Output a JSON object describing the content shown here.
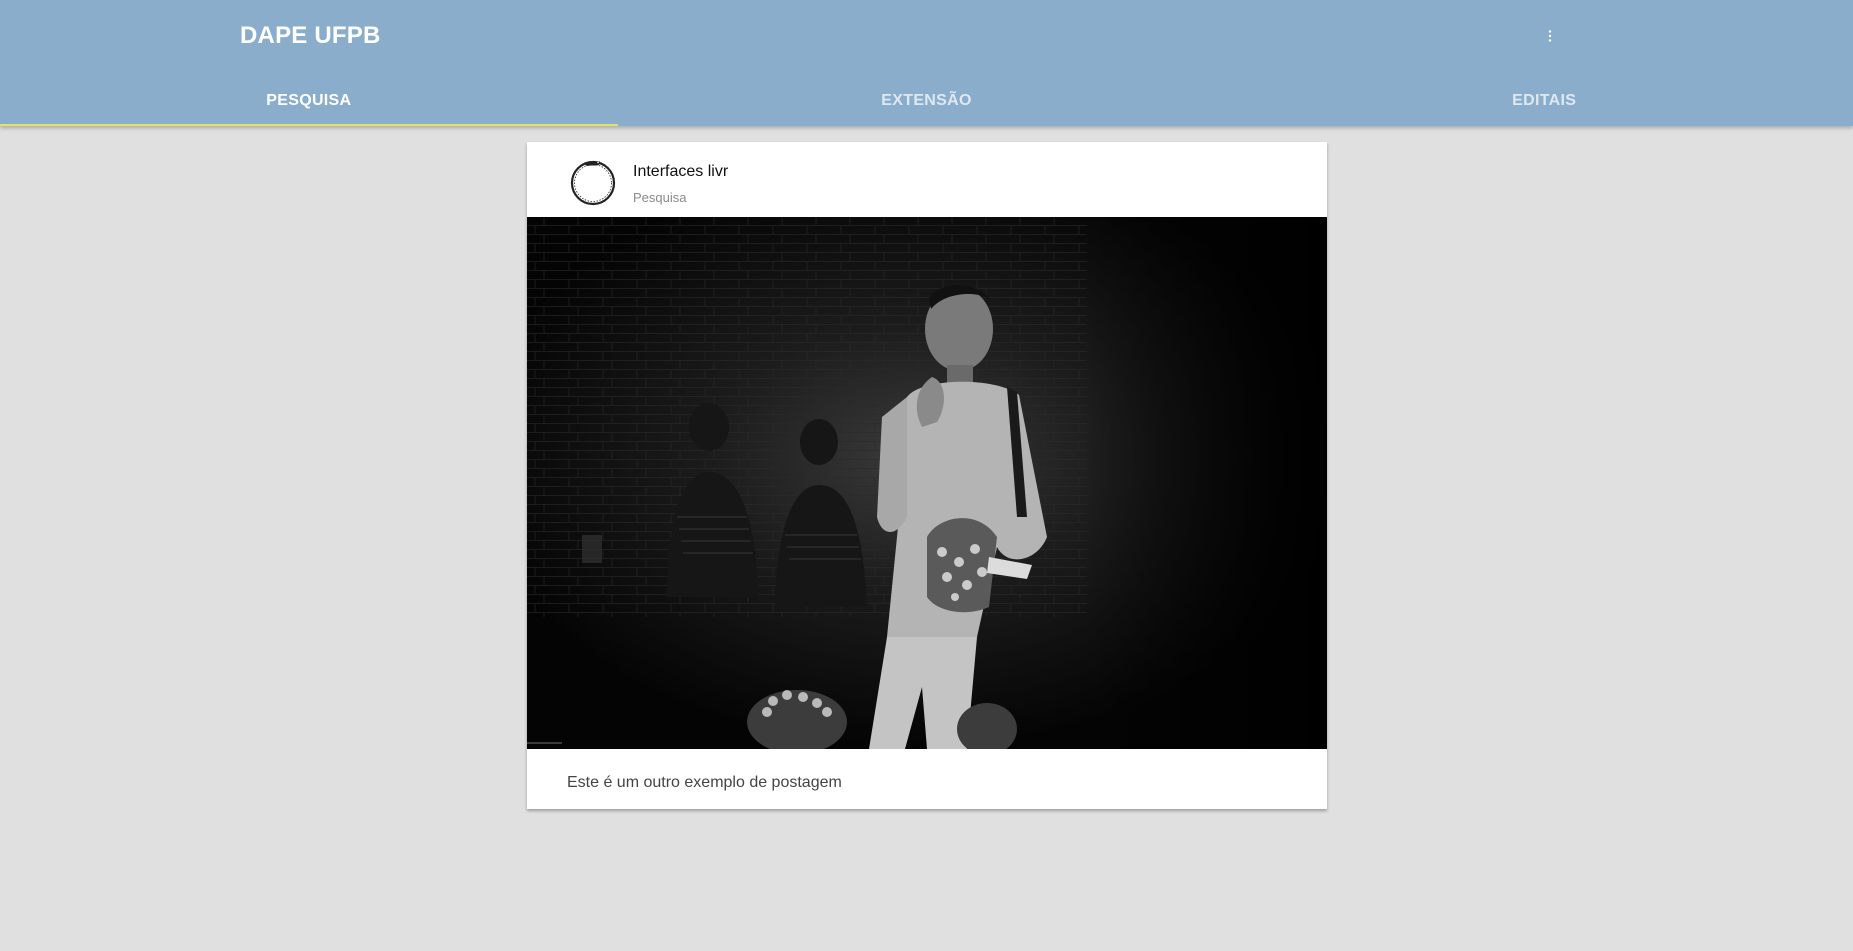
{
  "appbar": {
    "title": "DAPE UFPB",
    "menu_icon": "more-vertical-icon",
    "background": "#8aadcb"
  },
  "tabs": [
    {
      "label": "PESQUISA",
      "active": true
    },
    {
      "label": "EXTENSÃO",
      "active": false
    },
    {
      "label": "EDITAIS",
      "active": false
    }
  ],
  "tab_indicator_color": "#e2e26a",
  "post": {
    "title": "Interfaces livr",
    "subtitle": "Pesquisa",
    "avatar_icon": "ouroboros-icon",
    "image_description_icon": "theater-performer-photo",
    "text": "Este é um outro exemplo de postagem"
  }
}
